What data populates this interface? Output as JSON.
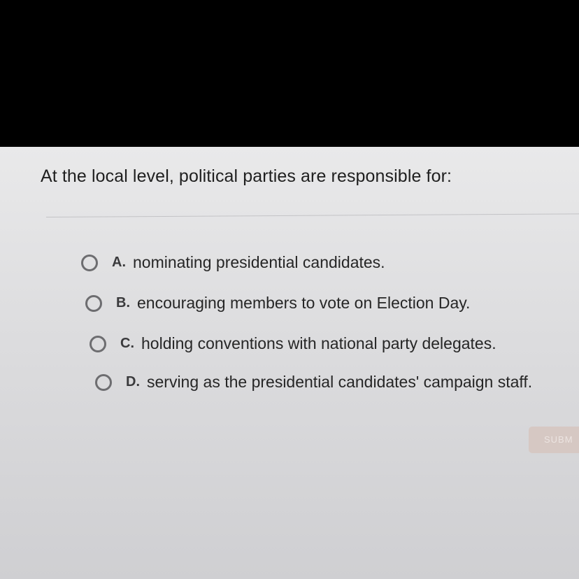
{
  "question": {
    "text": "At the local level, political parties are responsible for:"
  },
  "options": [
    {
      "letter": "A.",
      "text": "nominating presidential candidates.",
      "selected": false
    },
    {
      "letter": "B.",
      "text": "encouraging members to vote on Election Day.",
      "selected": false
    },
    {
      "letter": "C.",
      "text": "holding conventions with national party delegates.",
      "selected": false
    },
    {
      "letter": "D.",
      "text": "serving as the presidential candidates' campaign staff.",
      "selected": false
    }
  ],
  "submit": {
    "label": "SUBM",
    "enabled": false
  },
  "colors": {
    "background": "#e2e2e4",
    "text": "#1f1f1f",
    "radio_border": "#6d6d70",
    "submit_disabled": "#d6c8c3"
  }
}
